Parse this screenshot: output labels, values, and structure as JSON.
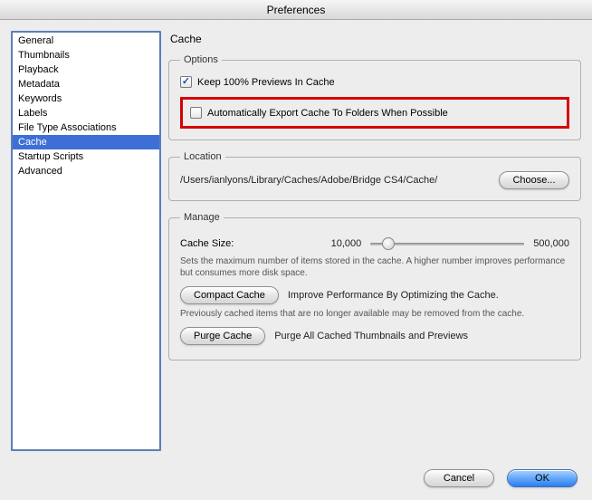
{
  "window": {
    "title": "Preferences"
  },
  "sidebar": {
    "items": [
      {
        "label": "General"
      },
      {
        "label": "Thumbnails"
      },
      {
        "label": "Playback"
      },
      {
        "label": "Metadata"
      },
      {
        "label": "Keywords"
      },
      {
        "label": "Labels"
      },
      {
        "label": "File Type Associations"
      },
      {
        "label": "Cache"
      },
      {
        "label": "Startup Scripts"
      },
      {
        "label": "Advanced"
      }
    ],
    "selected_index": 7
  },
  "page": {
    "title": "Cache"
  },
  "options": {
    "legend": "Options",
    "keep_previews": {
      "label": "Keep 100% Previews In Cache",
      "checked": true
    },
    "auto_export": {
      "label": "Automatically Export Cache To Folders When Possible",
      "checked": false
    }
  },
  "location": {
    "legend": "Location",
    "path": "/Users/ianlyons/Library/Caches/Adobe/Bridge CS4/Cache/",
    "choose_label": "Choose..."
  },
  "manage": {
    "legend": "Manage",
    "cache_size_label": "Cache Size:",
    "min": "10,000",
    "max": "500,000",
    "value_fraction": 0.08,
    "size_help": "Sets the maximum number of items stored in the cache. A higher number improves performance but consumes more disk space.",
    "compact_label": "Compact Cache",
    "compact_desc": "Improve Performance By Optimizing the Cache.",
    "compact_help": "Previously cached items that are no longer available may be removed from the cache.",
    "purge_label": "Purge Cache",
    "purge_desc": "Purge All Cached Thumbnails and Previews"
  },
  "footer": {
    "cancel": "Cancel",
    "ok": "OK"
  }
}
